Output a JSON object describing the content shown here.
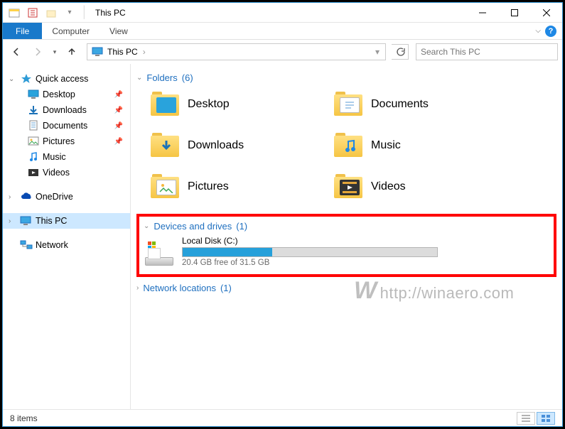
{
  "window": {
    "title": "This PC"
  },
  "ribbon": {
    "file": "File",
    "tabs": [
      "Computer",
      "View"
    ]
  },
  "address": {
    "location": "This PC"
  },
  "search": {
    "placeholder": "Search This PC"
  },
  "nav": {
    "quick_access": "Quick access",
    "items": [
      {
        "label": "Desktop"
      },
      {
        "label": "Downloads"
      },
      {
        "label": "Documents"
      },
      {
        "label": "Pictures"
      },
      {
        "label": "Music"
      },
      {
        "label": "Videos"
      }
    ],
    "onedrive": "OneDrive",
    "this_pc": "This PC",
    "network": "Network"
  },
  "groups": {
    "folders": {
      "title": "Folders",
      "count": 6
    },
    "drives": {
      "title": "Devices and drives",
      "count": 1
    },
    "network": {
      "title": "Network locations",
      "count": 1
    }
  },
  "folders": [
    {
      "label": "Desktop"
    },
    {
      "label": "Documents"
    },
    {
      "label": "Downloads"
    },
    {
      "label": "Music"
    },
    {
      "label": "Pictures"
    },
    {
      "label": "Videos"
    }
  ],
  "drive": {
    "label": "Local Disk (C:)",
    "free_text": "20.4 GB free of 31.5 GB",
    "used_gb": 11.1,
    "total_gb": 31.5,
    "fill_pct": 35.2
  },
  "watermark": "http://winaero.com",
  "status": {
    "items": "8 items"
  }
}
